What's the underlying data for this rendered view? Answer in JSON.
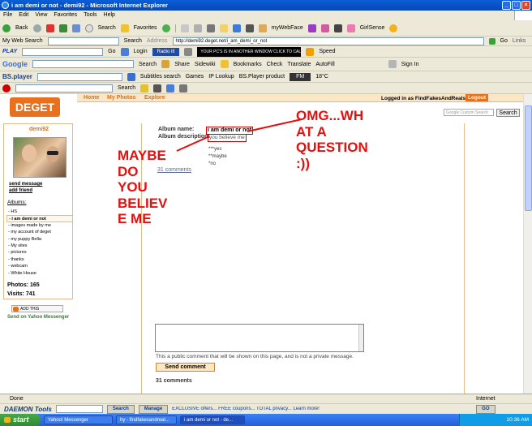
{
  "window": {
    "title": "i am demi or not - demi92 - Microsoft Internet Explorer"
  },
  "menu": [
    "File",
    "Edit",
    "View",
    "Favorites",
    "Tools",
    "Help"
  ],
  "toolbar": {
    "back": "Back",
    "search": "Search",
    "favorites": "Favorites",
    "mywebface": "myWebFace",
    "girlsense": "GirlSense",
    "websearch_label": "My Web Search",
    "search2": "Search",
    "address_label": "Address",
    "address": "http://demi92.deget.net/i_am_demi_or_not",
    "go": "Go",
    "links": "Links"
  },
  "toolbar2": {
    "play": "PLAY",
    "go": "Go",
    "login": "Login",
    "radio": "Radio ilt",
    "banner": "YOUR PC'S IS IN ANOTHER WINDOW CLICK TO CALL IT BACK",
    "speed": "Speed"
  },
  "toolbar3": {
    "google": "Google",
    "search": "Search",
    "share": "Share",
    "sidewiki": "Sidewiki",
    "bookmarks": "Bookmarks",
    "check": "Check",
    "translate": "Translate",
    "autofill": "AutoFill",
    "signin": "Sign In"
  },
  "toolbar4": {
    "bsplayer": "BS.player",
    "subtitles": "Subtitles search",
    "games": "Games",
    "iplookup": "IP Lookup",
    "bsproduct": "BS.Player product",
    "fm": "FM",
    "temp": "18°C"
  },
  "toolbar5": {
    "search": "Search"
  },
  "site": {
    "logo": "DEGET",
    "nav": [
      "Home",
      "My Photos",
      "Explore"
    ],
    "logged_in": "Logged in as FindFakesAndReals.",
    "logout": "Logout",
    "search_placeholder": "Google Custom Search",
    "search_button": "Search"
  },
  "sidebar": {
    "username": "demi92",
    "send_message": "send message",
    "add_friend": "add friend",
    "albums_label": "Albums:",
    "albums": [
      "- HS",
      "- i am demi or not",
      "- images made by me",
      "- my account of deget",
      "- my puppy Bella",
      "- My sites",
      "- pictures",
      "- thanks",
      "- webcam",
      "- White House"
    ],
    "photos": "Photos: 165",
    "visits": "Visits: 741",
    "addthis": "ADD THIS",
    "yahoo": "Send on Yahoo Messenger"
  },
  "album": {
    "name_label": "Album name:",
    "name": "i am demi or not",
    "desc_label": "Album description:",
    "desc": "you believe me",
    "options": [
      "***yes",
      "**maybe",
      "*no"
    ],
    "comments_link": "31 comments",
    "comment_note": "This a public comment that will be shown on this page, and is not a private message.",
    "send_button": "Send comment",
    "comments_count": "31 comments"
  },
  "annotations": {
    "left": [
      "MAYBE",
      "DO",
      "YOU",
      "BELIEV",
      "E ME"
    ],
    "right": [
      "OMG...WH",
      "AT A",
      "QUESTION",
      ":))"
    ]
  },
  "status": {
    "left": "Done",
    "zone": "Internet"
  },
  "daemon": {
    "title": "DAEMON Tools",
    "search": "Search",
    "manage": "Manage",
    "ad": "EXCLUSIVE offers... FREE coupons... TOTAL privacy... Learn more!",
    "go": "GO"
  },
  "taskbar": {
    "start": "start",
    "tasks": [
      "Yahoo! Messenger",
      "hy - findfakesandreal...",
      "i am demi or not - de..."
    ],
    "time": "10:36 AM"
  }
}
